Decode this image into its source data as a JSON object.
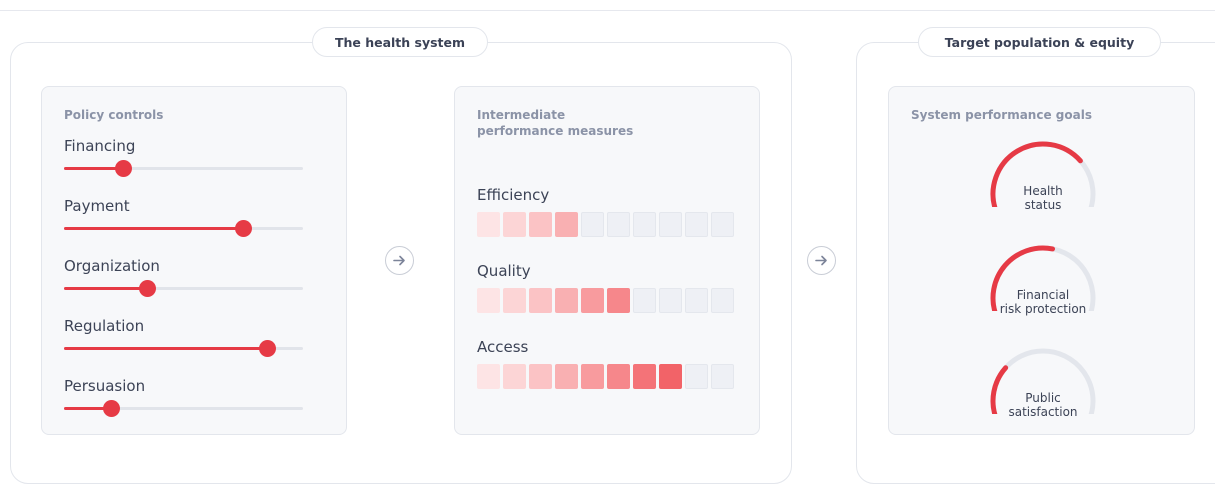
{
  "sections": {
    "health_system_title": "The health system",
    "target_population_title": "Target population & equity"
  },
  "policy_controls": {
    "title": "Policy controls",
    "sliders": [
      {
        "label": "Financing",
        "value": 0.25
      },
      {
        "label": "Payment",
        "value": 0.75
      },
      {
        "label": "Organization",
        "value": 0.35
      },
      {
        "label": "Regulation",
        "value": 0.85
      },
      {
        "label": "Persuasion",
        "value": 0.2
      }
    ]
  },
  "intermediate": {
    "title_line1": "Intermediate",
    "title_line2": "performance measures",
    "total_cells": 10,
    "measures": [
      {
        "label": "Efficiency",
        "level": 4
      },
      {
        "label": "Quality",
        "level": 6
      },
      {
        "label": "Access",
        "level": 8
      }
    ]
  },
  "goals": {
    "title": "System performance goals",
    "gauges": [
      {
        "label_line1": "Health",
        "label_line2": "status",
        "value": 0.72
      },
      {
        "label_line1": "Financial",
        "label_line2": "risk protection",
        "value": 0.55
      },
      {
        "label_line1": "Public",
        "label_line2": "satisfaction",
        "value": 0.28
      }
    ]
  },
  "colors": {
    "accent": "#e63a45",
    "cell_shades": [
      "#fde4e5",
      "#fcd5d6",
      "#fbc3c5",
      "#f9b0b2",
      "#f89b9e",
      "#f6878b",
      "#f47378",
      "#f26368"
    ],
    "track": "#e1e4ea",
    "gauge_track": "#e3e6ec"
  },
  "icons": {
    "connector_1": "arrow-right-icon",
    "connector_2": "arrow-right-icon"
  }
}
